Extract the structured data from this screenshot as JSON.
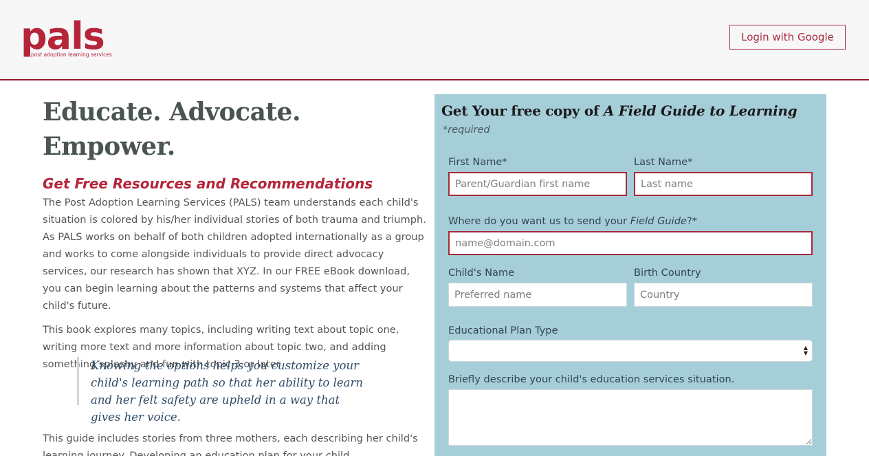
{
  "header": {
    "logo_word": "pals",
    "logo_tagline": "post adoption learning services",
    "login_label": "Login with Google"
  },
  "intro": {
    "title": "Educate. Advocate. Empower.",
    "subtitle": "Get Free Resources and Recommendations",
    "paragraph1": "The Post Adoption Learning Services (PALS) team understands each child's situation is colored by his/her individual stories of both trauma and triumph. As PALS works on behalf of both children adopted internationally as a group and works to come alongside individuals to provide direct advocacy services, our research has shown that XYZ. In our FREE eBook download, you can begin learning about the patterns and systems that affect your child's future.",
    "paragraph2": "This book explores many topics, including writing text about topic one, writing more text and more information about topic two, and adding something splashy and fun with topic 3 or later",
    "quote": "Knowing the options helps you customize your child's learning path so that her ability to learn and her felt safety are upheld in a way that gives her voice.",
    "paragraph3": "This guide includes stories from three mothers, each describing her child's learning journey. Developing an education plan for your child"
  },
  "form": {
    "title_prefix": "Get Your free copy of ",
    "title_book": "A Field Guide to Learning",
    "required_note": "*required",
    "first_name_label": "First Name*",
    "first_name_placeholder": "Parent/Guardian first name",
    "last_name_label": "Last Name*",
    "last_name_placeholder": "Last name",
    "email_label_prefix": "Where do you want us to send your ",
    "email_label_em": "Field Guide",
    "email_label_suffix": "?*",
    "email_placeholder": "name@domain.com",
    "child_name_label": "Child's Name",
    "child_name_placeholder": "Preferred name",
    "birth_country_label": "Birth Country",
    "birth_country_placeholder": "Country",
    "plan_type_label": "Educational Plan Type",
    "plan_type_value": "",
    "situation_label": "Briefly describe your child's education services situation."
  },
  "colors": {
    "brand": "#b5253a",
    "panel": "#a6ced9",
    "header_bg": "#f7f7f8"
  }
}
